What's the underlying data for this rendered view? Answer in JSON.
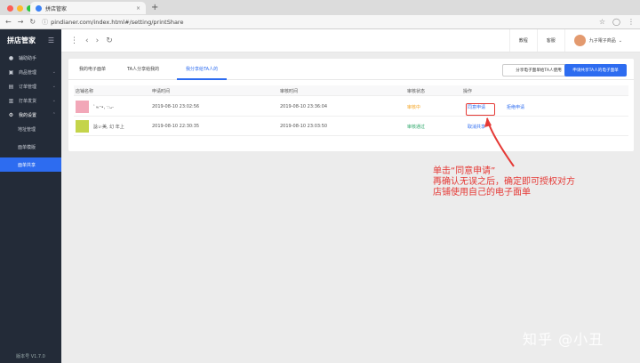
{
  "browser": {
    "tab_title": "拼店管家",
    "url": "pindianer.com/index.html#/setting/printShare"
  },
  "sidebar": {
    "logo_text": "拼店管家",
    "items": [
      {
        "label": "辅助助手",
        "icon": "●"
      },
      {
        "label": "商品管理",
        "icon": "▣"
      },
      {
        "label": "订单管理",
        "icon": "▤"
      },
      {
        "label": "打单发货",
        "icon": "▥"
      },
      {
        "label": "我的设置",
        "icon": "⚙"
      }
    ],
    "subitems": [
      {
        "label": "地址管理"
      },
      {
        "label": "面单模版"
      },
      {
        "label": "面单共享"
      }
    ],
    "version": "版本号 V1.7.0"
  },
  "topbar": {
    "tutorial": "教程",
    "service": "客服",
    "username": "九子電子商品"
  },
  "tabs": [
    {
      "label": "我的电子面单"
    },
    {
      "label": "TA人分享给我的"
    },
    {
      "label": "我分享给TA人的"
    }
  ],
  "buttons": {
    "share_other": "分享电子面单给TA人使用",
    "apply_share": "申请共享TA人的电子面单"
  },
  "table": {
    "headers": [
      "店铺名称",
      "申请时间",
      "审核时间",
      "审核状态",
      "操作"
    ],
    "rows": [
      {
        "store": "ﾞ≈ᵕ•, ∵ᴗ-",
        "apply_time": "2019-08-10 23:02:56",
        "review_time": "2019-08-10 23:36:04",
        "status": "审核中",
        "actions": [
          "同意申请",
          "拒绝申请"
        ],
        "thumb_color": "#f2a7b8"
      },
      {
        "store": "諗ぃ美, 幻 年上",
        "apply_time": "2019-08-10 22:30:35",
        "review_time": "2019-08-10 23:03:50",
        "status": "审核通过",
        "actions": [
          "取消共享"
        ],
        "thumb_color": "#c4d44a"
      }
    ]
  },
  "annotation": "单击“同意申请”\n再确认无误之后，确定即可授权对方\n店铺使用自己的电子面单",
  "watermark": "知乎 @小丑"
}
